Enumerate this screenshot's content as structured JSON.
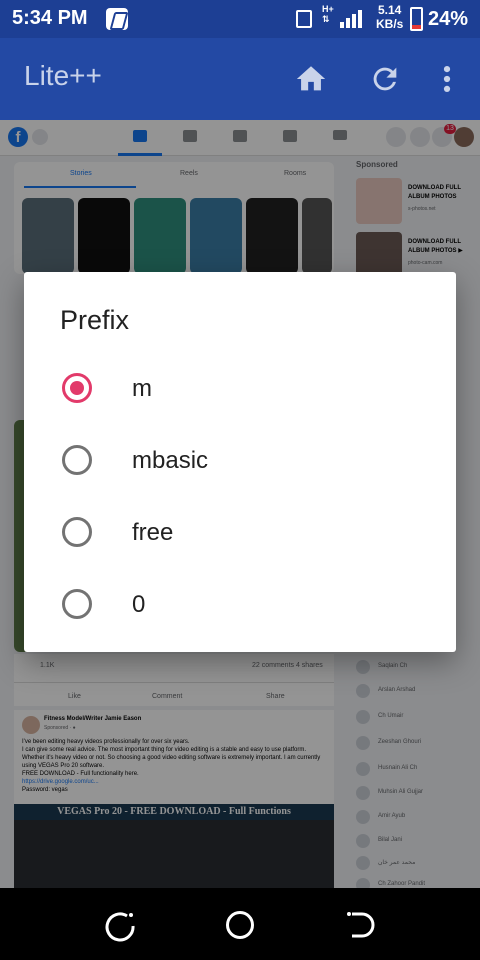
{
  "status_bar": {
    "time": "5:34 PM",
    "network_type_top": "H+",
    "network_type_bottom": "⇅",
    "speed_value": "5.14",
    "speed_unit": "KB/s",
    "battery_percent": "24%"
  },
  "app_bar": {
    "title": "Lite++",
    "icons": [
      "home-icon",
      "refresh-icon",
      "more-vert-icon"
    ]
  },
  "background": {
    "story_tabs": [
      "Stories",
      "Reels",
      "Rooms"
    ],
    "sponsored_heading": "Sponsored",
    "ads": [
      {
        "title": "DOWNLOAD FULL ALBUM PHOTOS",
        "url": "s-photos.net"
      },
      {
        "title": "DOWNLOAD FULL ALBUM PHOTOS ▶",
        "url": "photo-cam.com"
      }
    ],
    "notification_count": "13",
    "reaction_count": "1.1K",
    "comments_shares": "22 comments  4 shares",
    "actions": [
      "Like",
      "Comment",
      "Share"
    ],
    "contacts": [
      "Saqlain Ch",
      "Arslan Arshad",
      "Ch Umair",
      "Zeeshan Ghouri",
      "Husnain Ali Ch",
      "Muhsin Ali Gujjar",
      "Amir Ayub",
      "Bilal Jani",
      "محمد عمر خان",
      "Ch Zahoor Pandit"
    ],
    "post": {
      "author": "Fitness Model/Writer Jamie Eason",
      "sponsored": "Sponsored · ●",
      "lines": [
        "I've been editing heavy videos professionally for over six years.",
        "I can give some real advice. The most important thing for video editing is a stable and easy to use platform. Whether it's heavy video or not. So choosing a good video editing software is extremely important. I am currently using VEGAS Pro 20 software.",
        "FREE DOWNLOAD - Full functionality here.",
        "https://drive.google.com/uc...",
        "Password: vegas"
      ],
      "banner": "VEGAS Pro 20 - FREE DOWNLOAD - Full Functions"
    }
  },
  "dialog": {
    "title": "Prefix",
    "options": [
      {
        "label": "m",
        "selected": true
      },
      {
        "label": "mbasic",
        "selected": false
      },
      {
        "label": "free",
        "selected": false
      },
      {
        "label": "0",
        "selected": false
      }
    ],
    "accent_color": "#e23a6a"
  },
  "nav_bar": {
    "buttons": [
      "recents-icon",
      "home-circle-icon",
      "back-icon"
    ]
  }
}
